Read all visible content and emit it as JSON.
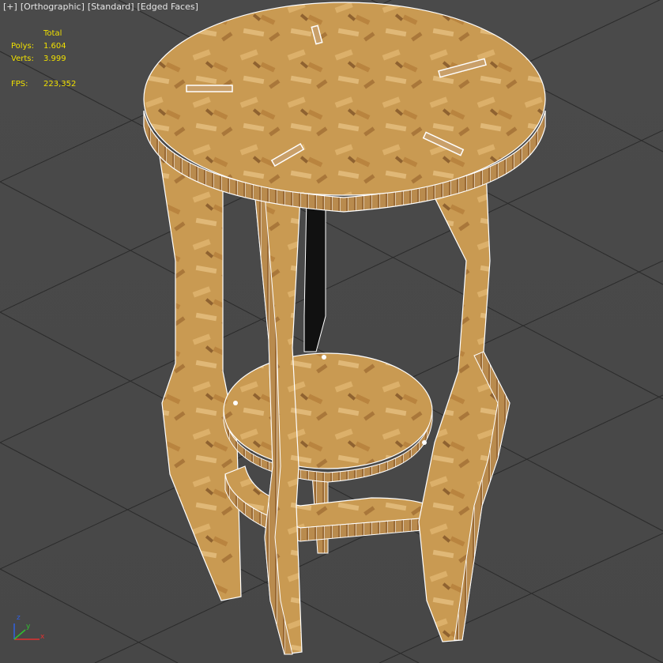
{
  "viewport_label": {
    "plus": "[+]",
    "view": "[Orthographic]",
    "shading": "[Standard]",
    "edged": "[Edged Faces]"
  },
  "stats": {
    "header": "Total",
    "polys_label": "Polys:",
    "polys_value": "1.604",
    "verts_label": "Verts:",
    "verts_value": "3.999",
    "fps_label": "FPS:",
    "fps_value": "223,352"
  },
  "axis_gizmo": {
    "x": "x",
    "y": "y",
    "z": "z"
  },
  "colors": {
    "background": "#4b4b4b",
    "grid": "#2c2c2c",
    "stats_text": "#f0e000",
    "wood": "#c99a52",
    "wood_dark": "#a9793a",
    "edge": "#ffffff"
  }
}
